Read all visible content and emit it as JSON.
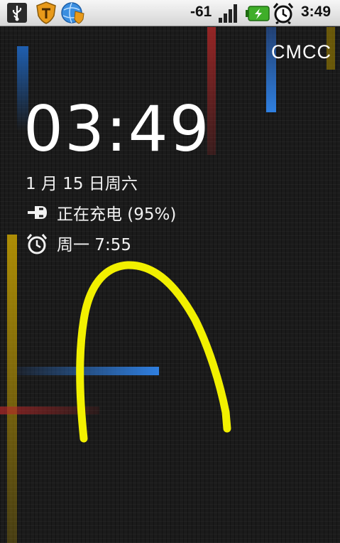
{
  "status_bar": {
    "signal_strength": "-61",
    "time": "3:49",
    "icons": [
      "usb-icon",
      "security-shield-icon",
      "globe-shield-icon",
      "signal-bars-icon",
      "battery-charging-icon",
      "alarm-clock-icon"
    ]
  },
  "lockscreen": {
    "carrier": "CMCC",
    "clock": "03:49",
    "date": "1 月 15 日周六",
    "charging": "正在充电 (95%)",
    "alarm": "周一 7:55"
  },
  "colors": {
    "gesture_stroke": "#f2f000",
    "accent_blue": "#2f7fe0",
    "accent_red": "#c0392b",
    "accent_yellow": "#e2b400"
  }
}
